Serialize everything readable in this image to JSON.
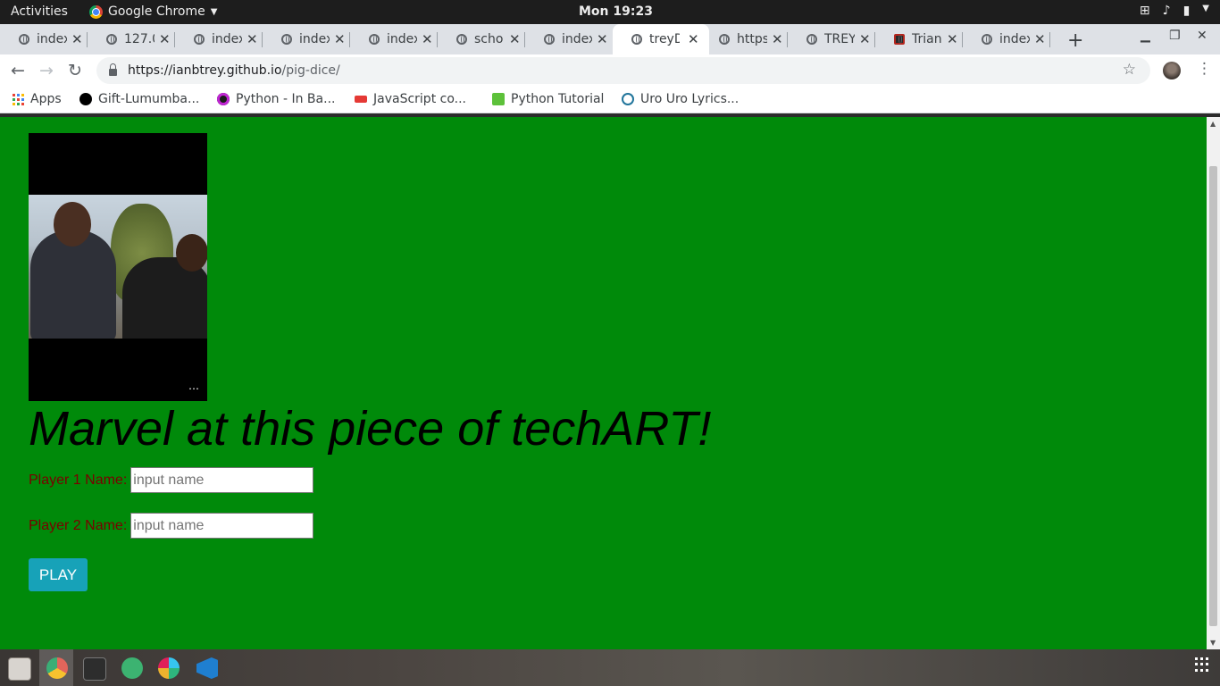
{
  "system_bar": {
    "activities": "Activities",
    "app_name": "Google Chrome",
    "clock": "Mon 19:23"
  },
  "tabs": [
    {
      "title": "index"
    },
    {
      "title": "127.0"
    },
    {
      "title": "index"
    },
    {
      "title": "index"
    },
    {
      "title": "index"
    },
    {
      "title": "scho"
    },
    {
      "title": "index"
    },
    {
      "title": "treyD",
      "active": true
    },
    {
      "title": "https"
    },
    {
      "title": "TREY"
    },
    {
      "title": "Trian"
    },
    {
      "title": "index"
    }
  ],
  "address_bar": {
    "url_host": "https://ianbtrey.github.io",
    "url_path": "/pig-dice/"
  },
  "bookmarks": [
    {
      "label": "Apps",
      "icon": "apps-grid-icon"
    },
    {
      "label": "Gift-Lumumba...",
      "icon": "github-icon"
    },
    {
      "label": "Python - In Ba...",
      "icon": "p-logo-icon"
    },
    {
      "label": "JavaScript co...",
      "icon": "w3-red-icon"
    },
    {
      "label": "Python Tutorial",
      "icon": "w3schools-icon"
    },
    {
      "label": "Uro Uro Lyrics...",
      "icon": "wordpress-icon"
    }
  ],
  "page": {
    "background": "#008a0a",
    "headline": "Marvel at this piece of techART!",
    "player1_label": "Player 1 Name:",
    "player2_label": "Player 2 Name:",
    "input_placeholder": "input name",
    "play_label": "PLAY",
    "video_menu": "…"
  }
}
